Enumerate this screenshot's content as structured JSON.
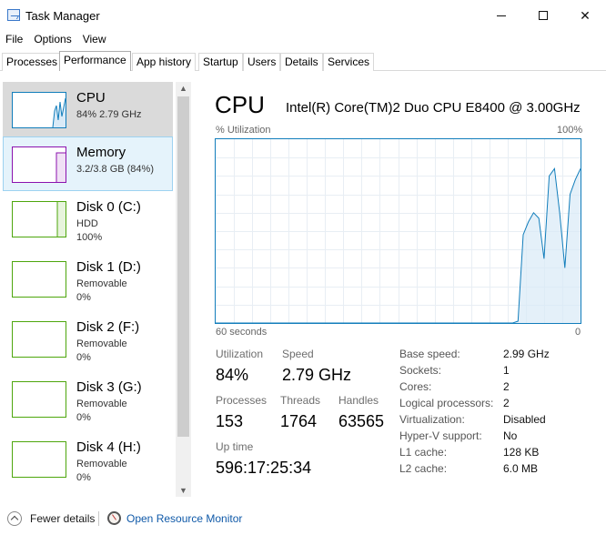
{
  "window": {
    "title": "Task Manager",
    "controls": {
      "minimize": "minimize",
      "maximize": "maximize",
      "close": "✕"
    }
  },
  "menu": [
    "File",
    "Options",
    "View"
  ],
  "tabs": [
    {
      "label": "Processes",
      "active": false
    },
    {
      "label": "Performance",
      "active": true
    },
    {
      "label": "App history",
      "active": false
    },
    {
      "label": "Startup",
      "active": false
    },
    {
      "label": "Users",
      "active": false
    },
    {
      "label": "Details",
      "active": false
    },
    {
      "label": "Services",
      "active": false
    }
  ],
  "sidebar": {
    "items": [
      {
        "name": "CPU",
        "line1": "84% 2.79 GHz",
        "line2": "",
        "color": "#117dbb",
        "state": "selected"
      },
      {
        "name": "Memory",
        "line1": "3.2/3.8 GB (84%)",
        "line2": "",
        "color": "#8b12ae",
        "state": "hover"
      },
      {
        "name": "Disk 0 (C:)",
        "line1": "HDD",
        "line2": "100%",
        "color": "#4da60c",
        "state": ""
      },
      {
        "name": "Disk 1 (D:)",
        "line1": "Removable",
        "line2": "0%",
        "color": "#4da60c",
        "state": ""
      },
      {
        "name": "Disk 2 (F:)",
        "line1": "Removable",
        "line2": "0%",
        "color": "#4da60c",
        "state": ""
      },
      {
        "name": "Disk 3 (G:)",
        "line1": "Removable",
        "line2": "0%",
        "color": "#4da60c",
        "state": ""
      },
      {
        "name": "Disk 4 (H:)",
        "line1": "Removable",
        "line2": "0%",
        "color": "#4da60c",
        "state": ""
      }
    ]
  },
  "main": {
    "title": "CPU",
    "model": "Intel(R) Core(TM)2 Duo CPU E8400 @ 3.00GHz",
    "graph": {
      "ylabel": "% Utilization",
      "ymax_label": "100%",
      "xleft_label": "60 seconds",
      "xright_label": "0",
      "line_color": "#117dbb",
      "utilization_history": [
        0,
        0,
        0,
        0,
        0,
        0,
        0,
        0,
        0,
        0,
        0,
        0,
        0,
        0,
        0,
        0,
        0,
        0,
        0,
        0,
        0,
        0,
        0,
        0,
        0,
        0,
        0,
        0,
        0,
        0,
        0,
        0,
        0,
        0,
        0,
        0,
        0,
        0,
        0,
        0,
        0,
        0,
        0,
        0,
        0,
        0,
        0,
        0,
        0,
        0,
        0,
        0,
        0,
        0,
        0,
        0,
        0,
        0,
        1,
        48,
        55,
        60,
        57,
        35,
        80,
        84,
        60,
        30,
        70,
        78,
        84
      ]
    },
    "stats": {
      "utilization": {
        "label": "Utilization",
        "value": "84%"
      },
      "speed": {
        "label": "Speed",
        "value": "2.79 GHz"
      },
      "processes": {
        "label": "Processes",
        "value": "153"
      },
      "threads": {
        "label": "Threads",
        "value": "1764"
      },
      "handles": {
        "label": "Handles",
        "value": "63565"
      },
      "uptime": {
        "label": "Up time",
        "value": "596:17:25:34"
      }
    },
    "specs": [
      {
        "label": "Base speed:",
        "value": "2.99 GHz"
      },
      {
        "label": "Sockets:",
        "value": "1"
      },
      {
        "label": "Cores:",
        "value": "2"
      },
      {
        "label": "Logical processors:",
        "value": "2"
      },
      {
        "label": "Virtualization:",
        "value": "Disabled"
      },
      {
        "label": "Hyper-V support:",
        "value": "No"
      },
      {
        "label": "L1 cache:",
        "value": "128 KB"
      },
      {
        "label": "L2 cache:",
        "value": "6.0 MB"
      }
    ]
  },
  "footer": {
    "fewer_details": "Fewer details",
    "open_resource_monitor": "Open Resource Monitor"
  }
}
